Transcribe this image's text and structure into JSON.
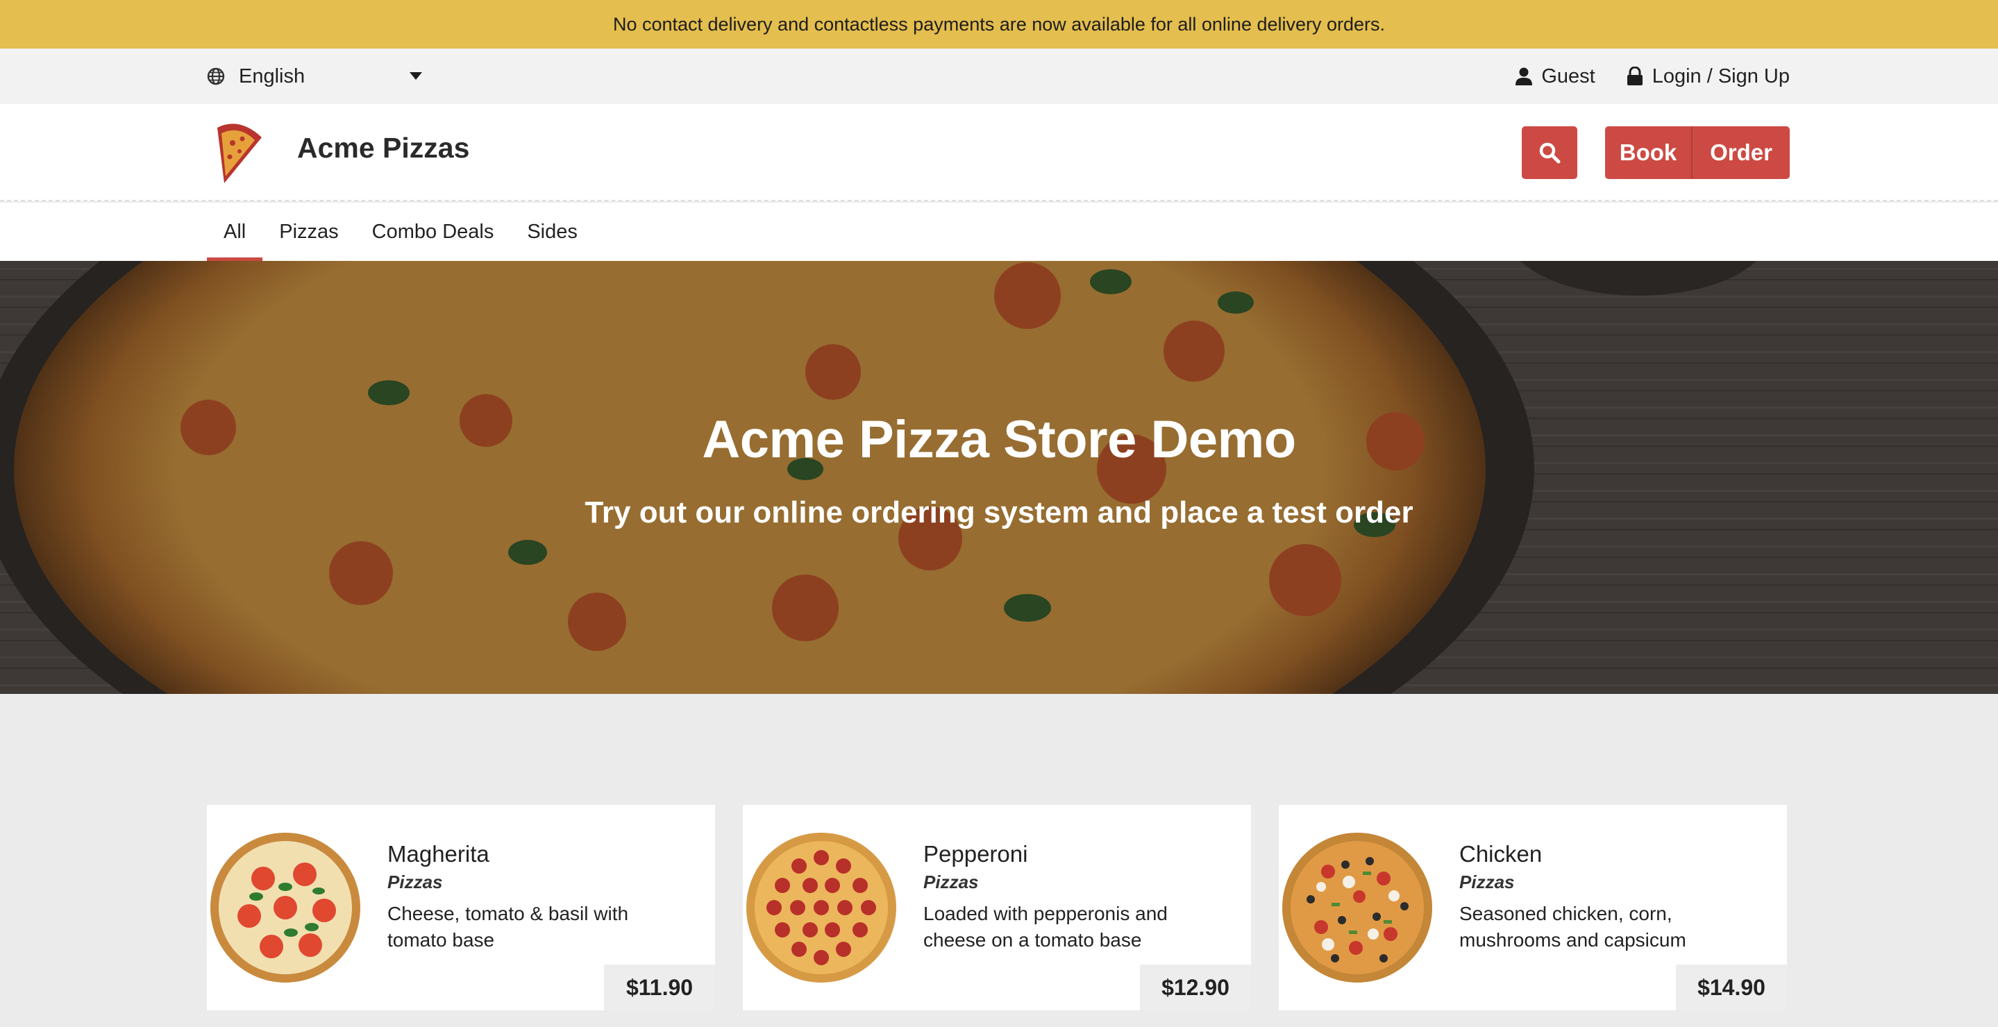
{
  "announcement": "No contact delivery and contactless payments are now available for all online delivery orders.",
  "utility": {
    "language": "English",
    "guest": "Guest",
    "login": "Login / Sign Up"
  },
  "header": {
    "brand": "Acme Pizzas",
    "book_label": "Book",
    "order_label": "Order"
  },
  "nav": {
    "tabs": [
      {
        "label": "All",
        "active": true
      },
      {
        "label": "Pizzas",
        "active": false
      },
      {
        "label": "Combo Deals",
        "active": false
      },
      {
        "label": "Sides",
        "active": false
      }
    ]
  },
  "hero": {
    "title": "Acme Pizza Store Demo",
    "subtitle": "Try out our online ordering system and place a test order"
  },
  "products": [
    {
      "name": "Magherita",
      "category": "Pizzas",
      "description": "Cheese, tomato & basil with tomato base",
      "price": "$11.90"
    },
    {
      "name": "Pepperoni",
      "category": "Pizzas",
      "description": "Loaded with pepperonis and cheese on a tomato base",
      "price": "$12.90"
    },
    {
      "name": "Chicken",
      "category": "Pizzas",
      "description": "Seasoned chicken, corn, mushrooms and capsicum",
      "price": "$14.90"
    }
  ],
  "colors": {
    "accent": "#cc4a43",
    "announcement_bg": "#e4be4e",
    "page_bg": "#ebebeb"
  },
  "icons": {
    "language": "globe-icon",
    "guest": "user-icon",
    "login": "lock-icon",
    "search": "search-icon",
    "logo": "pizza-slice-logo"
  }
}
